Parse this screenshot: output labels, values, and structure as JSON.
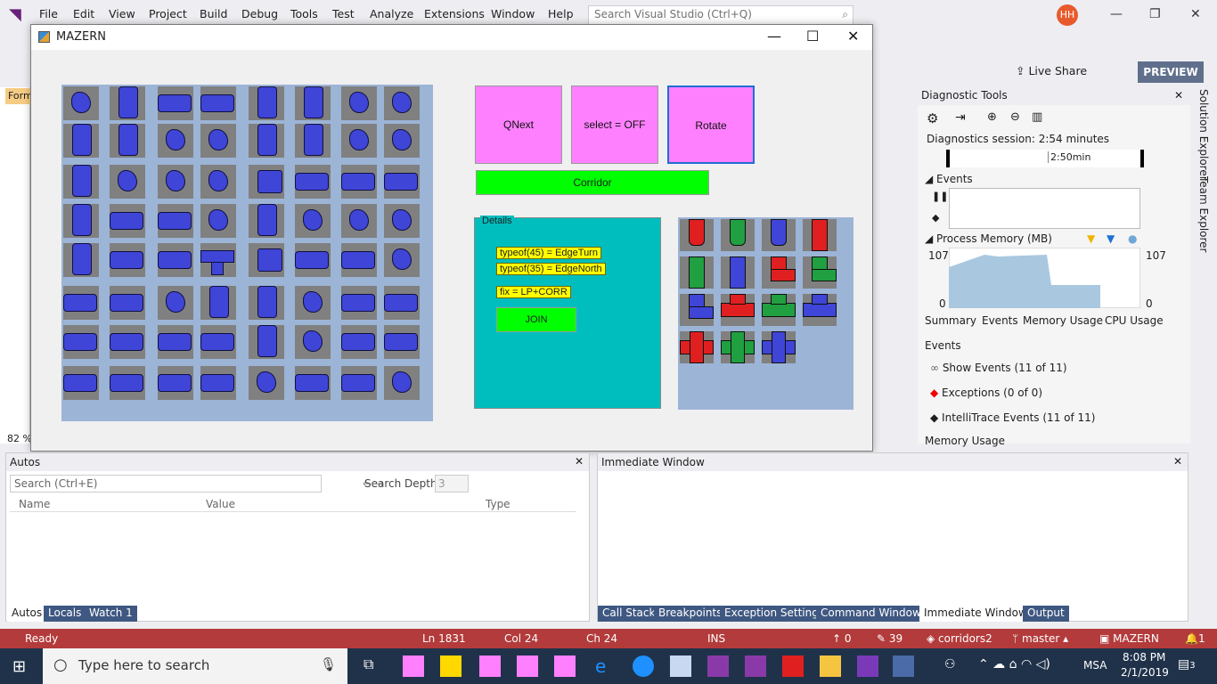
{
  "vs": {
    "menu": [
      "File",
      "Edit",
      "View",
      "Project",
      "Build",
      "Debug",
      "Tools",
      "Test",
      "Analyze",
      "Extensions",
      "Window",
      "Help"
    ],
    "search_placeholder": "Search Visual Studio (Ctrl+Q)",
    "avatar": "HH",
    "live_share": "Live Share",
    "preview": "PREVIEW",
    "form_tab": "Form",
    "zoom": "82 %"
  },
  "mazern": {
    "title": "MAZERN",
    "buttons": {
      "qnext": "QNext",
      "select": "select = OFF",
      "rotate": "Rotate",
      "corridor": "Corridor",
      "join": "JOIN"
    },
    "details_title": "Details",
    "labels": [
      "typeof(45) = EdgeTurn",
      "typeof(35) = EdgeNorth",
      "fix = LP+CORR"
    ],
    "colors": {
      "pink": "#ff80ff",
      "green": "#00ff00",
      "teal": "#00bebe",
      "yellow": "#ffff00",
      "blue_piece": "#3f45d6",
      "grid_bg": "#9cb4d6"
    }
  },
  "diag": {
    "title": "Diagnostic Tools",
    "session": "Diagnostics session: 2:54 minutes",
    "time_mark": "2:50min",
    "events_label": "Events",
    "process_memory": "Process Memory (MB)",
    "mem_max_left": "107",
    "mem_max_right": "107",
    "mem_min_left": "0",
    "mem_min_right": "0",
    "tabs": [
      "Summary",
      "Events",
      "Memory Usage",
      "CPU Usage"
    ],
    "events_heading": "Events",
    "event_rows": [
      "Show Events (11 of 11)",
      "Exceptions (0 of 0)",
      "IntelliTrace Events (11 of 11)"
    ],
    "memory_usage": "Memory Usage"
  },
  "side_tabs": [
    "Solution Explorer",
    "Team Explorer"
  ],
  "autos": {
    "title": "Autos",
    "search_placeholder": "Search (Ctrl+E)",
    "search_depth_label": "Search Depth:",
    "search_depth": "3",
    "columns": [
      "Name",
      "Value",
      "Type"
    ]
  },
  "immediate": {
    "title": "Immediate Window"
  },
  "bottom_tabs_left": [
    "Autos",
    "Locals",
    "Watch 1"
  ],
  "bottom_tabs_right": [
    "Call Stack",
    "Breakpoints",
    "Exception Settings",
    "Command Window",
    "Immediate Window",
    "Output"
  ],
  "status": {
    "ready": "Ready",
    "ln": "Ln 1831",
    "col": "Col 24",
    "ch": "Ch 24",
    "ins": "INS",
    "up": "0",
    "pencil": "39",
    "repo": "corridors2",
    "branch": "master",
    "project": "MAZERN",
    "notif": "1"
  },
  "taskbar": {
    "search": "Type here to search",
    "time": "8:08 PM",
    "date": "2/1/2019",
    "lang": "MSA",
    "notif_count": "3"
  }
}
